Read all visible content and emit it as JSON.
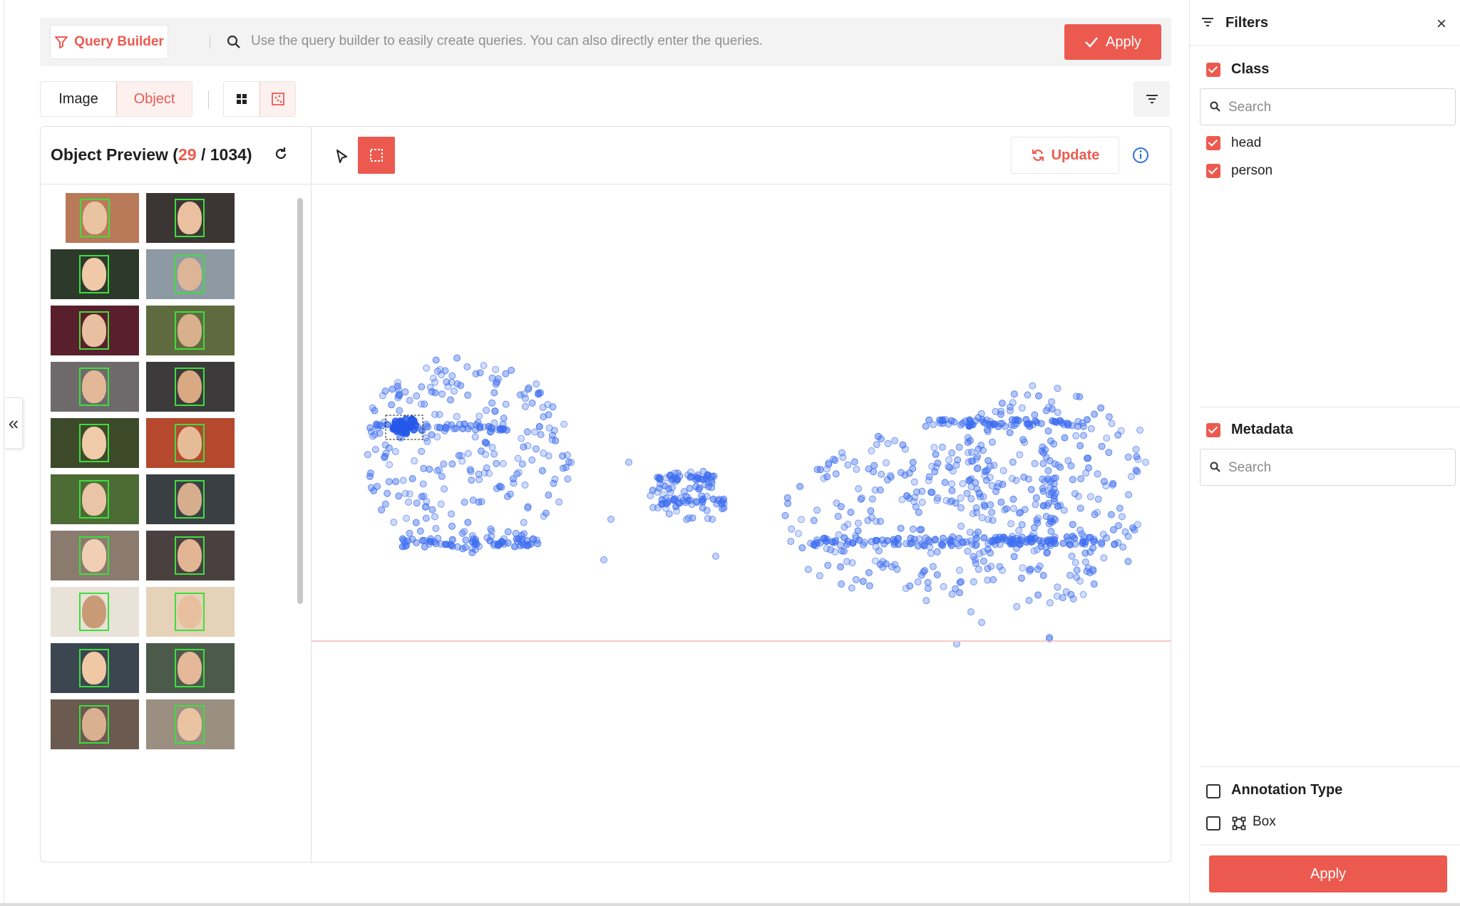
{
  "query_bar": {
    "builder_label": "Query Builder",
    "placeholder": "Use the query builder to easily create queries. You can also directly enter the queries.",
    "apply_label": "Apply"
  },
  "view_tabs": [
    {
      "label": "Image",
      "active": false
    },
    {
      "label": "Object",
      "active": true
    }
  ],
  "preview": {
    "title_prefix": "Object Preview (",
    "selected_count": "29",
    "separator": " / ",
    "total_count": "1034",
    "title_suffix": ")",
    "thumbnail_count": 20
  },
  "toolbar": {
    "update_label": "Update",
    "pointer_icon": "cursor-arrow-icon",
    "select_icon": "box-select-icon",
    "info_icon": "info-icon"
  },
  "scatter": {
    "cluster_description_colors": {
      "point": "#3d6df0",
      "selected_point": "#2458e8",
      "baseline": "#f6c9cc"
    }
  },
  "filters": {
    "title": "Filters",
    "class_section": {
      "label": "Class",
      "checked": true,
      "search_placeholder": "Search",
      "items": [
        {
          "label": "head",
          "checked": true
        },
        {
          "label": "person",
          "checked": true
        }
      ]
    },
    "metadata_section": {
      "label": "Metadata",
      "checked": true,
      "search_placeholder": "Search"
    },
    "annotation_section": {
      "label": "Annotation Type",
      "checked": false,
      "items": [
        {
          "label": "Box",
          "checked": false
        }
      ]
    },
    "apply_label": "Apply"
  },
  "colors": {
    "accent": "#ec5a4f",
    "bbox": "#3dde3d",
    "point": "#3d6df0"
  }
}
